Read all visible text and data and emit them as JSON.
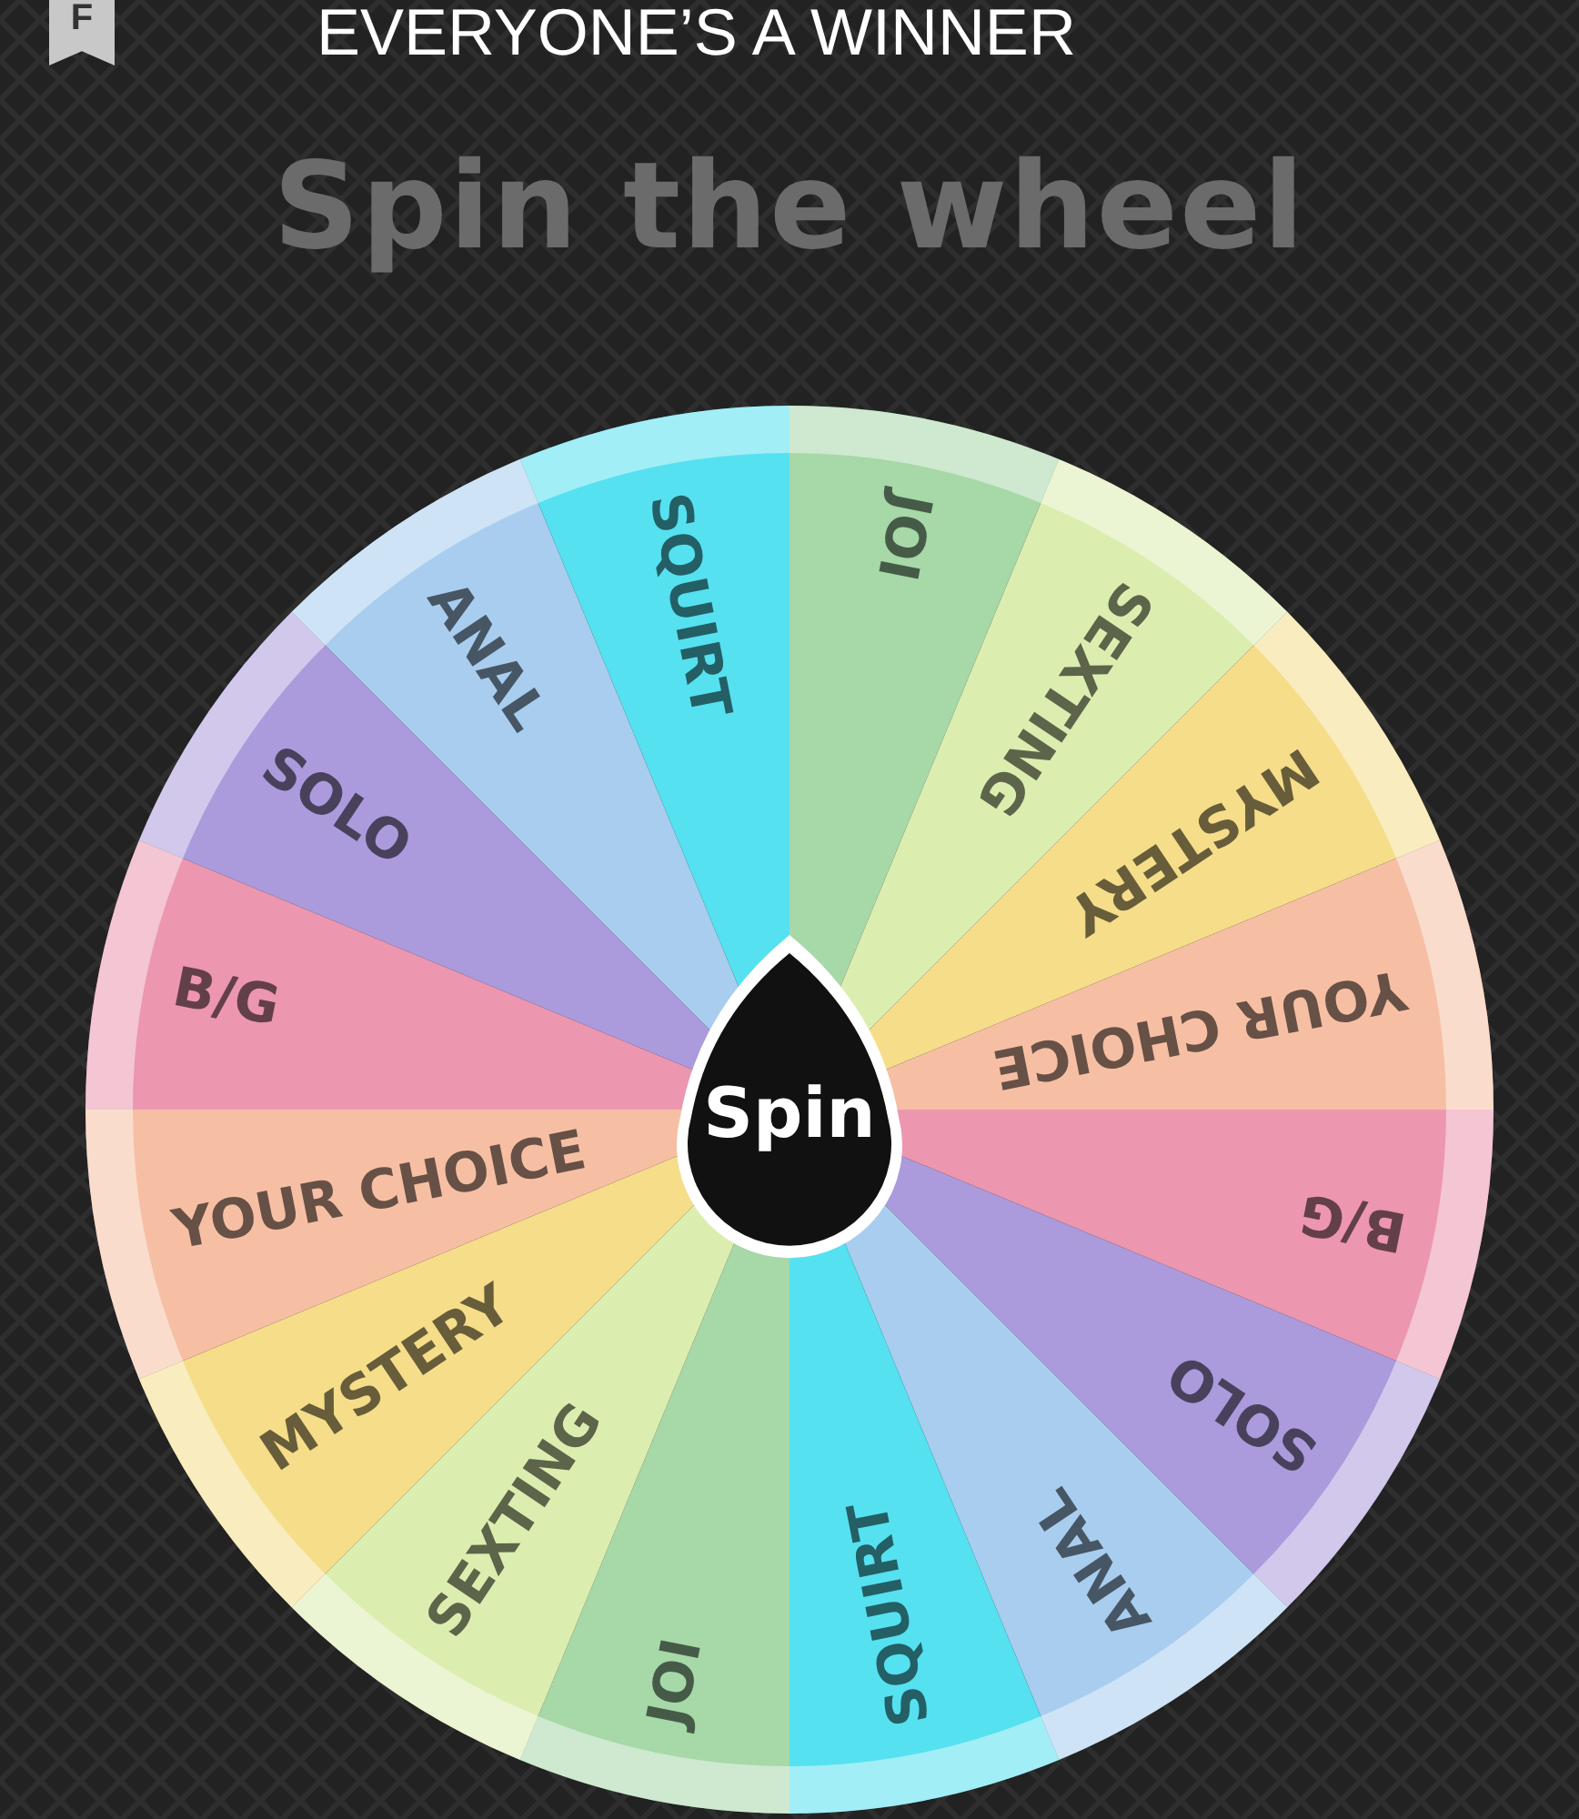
{
  "header": {
    "badge_letter": "F",
    "title": "EVERYONE’S A WINNER"
  },
  "heading": "Spin the wheel",
  "wheel": {
    "spin_button": "Spin",
    "segments": [
      {
        "label": "JOI",
        "color": "#a6d8a8"
      },
      {
        "label": "SEXTING",
        "color": "#dcedb0"
      },
      {
        "label": "MYSTERY",
        "color": "#f5dd8a"
      },
      {
        "label": "YOUR CHOICE",
        "color": "#f6bfa4"
      },
      {
        "label": "B/G",
        "color": "#ec96b0"
      },
      {
        "label": "SOLO",
        "color": "#ab9bdc"
      },
      {
        "label": "ANAL",
        "color": "#a8cdef"
      },
      {
        "label": "SQUIRT",
        "color": "#55e1f0"
      },
      {
        "label": "JOI",
        "color": "#a6d8a8"
      },
      {
        "label": "SEXTING",
        "color": "#dcedb0"
      },
      {
        "label": "MYSTERY",
        "color": "#f5dd8a"
      },
      {
        "label": "YOUR CHOICE",
        "color": "#f6bfa4"
      },
      {
        "label": "B/G",
        "color": "#ec96b0"
      },
      {
        "label": "SOLO",
        "color": "#ab9bdc"
      },
      {
        "label": "ANAL",
        "color": "#a8cdef"
      },
      {
        "label": "SQUIRT",
        "color": "#55e1f0"
      }
    ]
  }
}
